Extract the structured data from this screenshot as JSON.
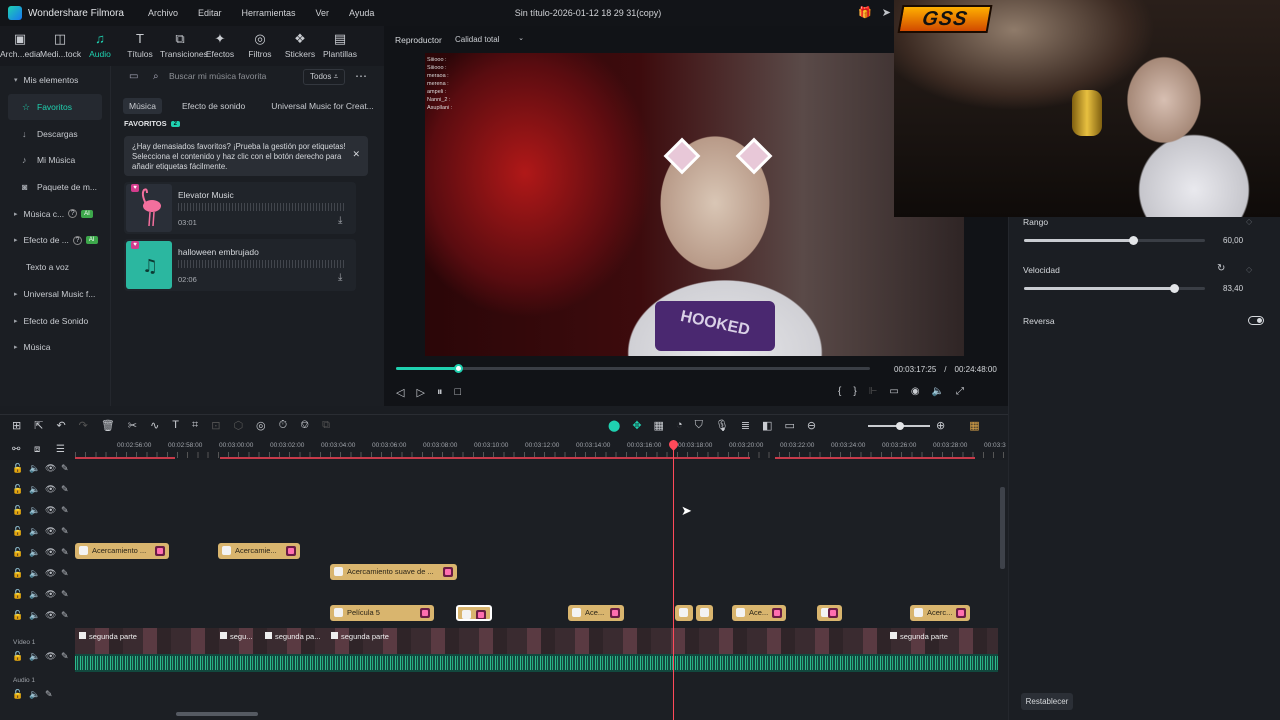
{
  "app": {
    "name": "Wondershare Filmora",
    "menu": [
      "Archivo",
      "Editar",
      "Herramientas",
      "Ver",
      "Ayuda"
    ],
    "document_title": "Sin título-2026-01-12 18 29 31(copy)"
  },
  "toolbar": [
    {
      "label": "Arch...edia",
      "icon": "folder-icon"
    },
    {
      "label": "Medi...tock",
      "icon": "stock-icon"
    },
    {
      "label": "Audio",
      "icon": "music-note-icon",
      "active": true
    },
    {
      "label": "Títulos",
      "icon": "text-icon"
    },
    {
      "label": "Transiciones",
      "icon": "transition-icon"
    },
    {
      "label": "Efectos",
      "icon": "effects-icon"
    },
    {
      "label": "Filtros",
      "icon": "filter-icon"
    },
    {
      "label": "Stickers",
      "icon": "sticker-icon"
    },
    {
      "label": "Plantillas",
      "icon": "template-icon"
    }
  ],
  "sidebar": {
    "items": [
      {
        "label": "Mis elementos",
        "type": "header"
      },
      {
        "label": "Favoritos",
        "selected": true
      },
      {
        "label": "Descargas"
      },
      {
        "label": "Mi Música"
      },
      {
        "label": "Paquete de m..."
      },
      {
        "label": "Música c...",
        "ai": "AI"
      },
      {
        "label": "Efecto de ...",
        "ai": "AI"
      },
      {
        "label": "Texto a voz"
      },
      {
        "label": "Universal Music f..."
      },
      {
        "label": "Efecto de Sonido"
      },
      {
        "label": "Música"
      }
    ]
  },
  "media": {
    "search_placeholder": "Buscar mi música favorita",
    "filter": "Todos",
    "tabs": [
      "Música",
      "Efecto de sonido",
      "Universal Music for Creat..."
    ],
    "favorites_label": "FAVORITOS",
    "favorites_count": "2",
    "tip": "¿Hay demasiados favoritos? ¡Prueba la gestión por etiquetas! Selecciona el contenido y haz clic con el botón derecho para añadir etiquetas fácilmente.",
    "tracks": [
      {
        "name": "Elevator Music",
        "duration": "03:01",
        "thumb_color": "#2a2f38"
      },
      {
        "name": "halloween embrujado",
        "duration": "02:06",
        "thumb_color": "#2bb7a0"
      }
    ]
  },
  "player": {
    "label": "Reproductor",
    "quality": "Calidad total",
    "current_time": "00:03:17:25",
    "separator": "/",
    "total_time": "00:24:48:00",
    "progress": 0.13,
    "overlay_chat": [
      "Siiiooo :",
      "Siiiooo : ",
      "meraoa :",
      "merena :",
      "ampeli :",
      "Nanni_2 :",
      "Asupllani :"
    ],
    "shirt_text": "HOOKED"
  },
  "webcam": {
    "logo": "GSS"
  },
  "properties": {
    "rango_label": "Rango",
    "rango_value": "60,00",
    "rango_level": 0.6,
    "velocidad_label": "Velocidad",
    "velocidad_value": "83,40",
    "velocidad_level": 0.83,
    "reversa_label": "Reversa",
    "reset_button": "Restablecer"
  },
  "timeline": {
    "ruler_ticks": [
      "00:02:56:00",
      "00:02:58:00",
      "00:03:00:00",
      "00:03:02:00",
      "00:03:04:00",
      "00:03:06:00",
      "00:03:08:00",
      "00:03:10:00",
      "00:03:12:00",
      "00:03:14:00",
      "00:03:16:00",
      "00:03:18:00",
      "00:03:20:00",
      "00:03:22:00",
      "00:03:24:00",
      "00:03:26:00",
      "00:03:28:00",
      "00:03:3"
    ],
    "video_track_label": "Vídeo 1",
    "audio_track_label": "Audio 1",
    "clips": [
      {
        "label": "Acercamiento ...",
        "row": 4
      },
      {
        "label": "Acercamie...",
        "row": 4
      },
      {
        "label": "Acercamiento suave de ...",
        "row": 5
      },
      {
        "label": "Película 5",
        "row": 7
      },
      {
        "label": "",
        "row": 7,
        "selected": true
      },
      {
        "label": "Ace...",
        "row": 7
      },
      {
        "label": "",
        "row": 7
      },
      {
        "label": "",
        "row": 7
      },
      {
        "label": "Ace...",
        "row": 7
      },
      {
        "label": "",
        "row": 7
      },
      {
        "label": "Acerc...",
        "row": 7
      }
    ],
    "video_clips": [
      "segunda parte",
      "segu...",
      "segunda pa...",
      "segunda parte",
      "segunda parte"
    ]
  }
}
